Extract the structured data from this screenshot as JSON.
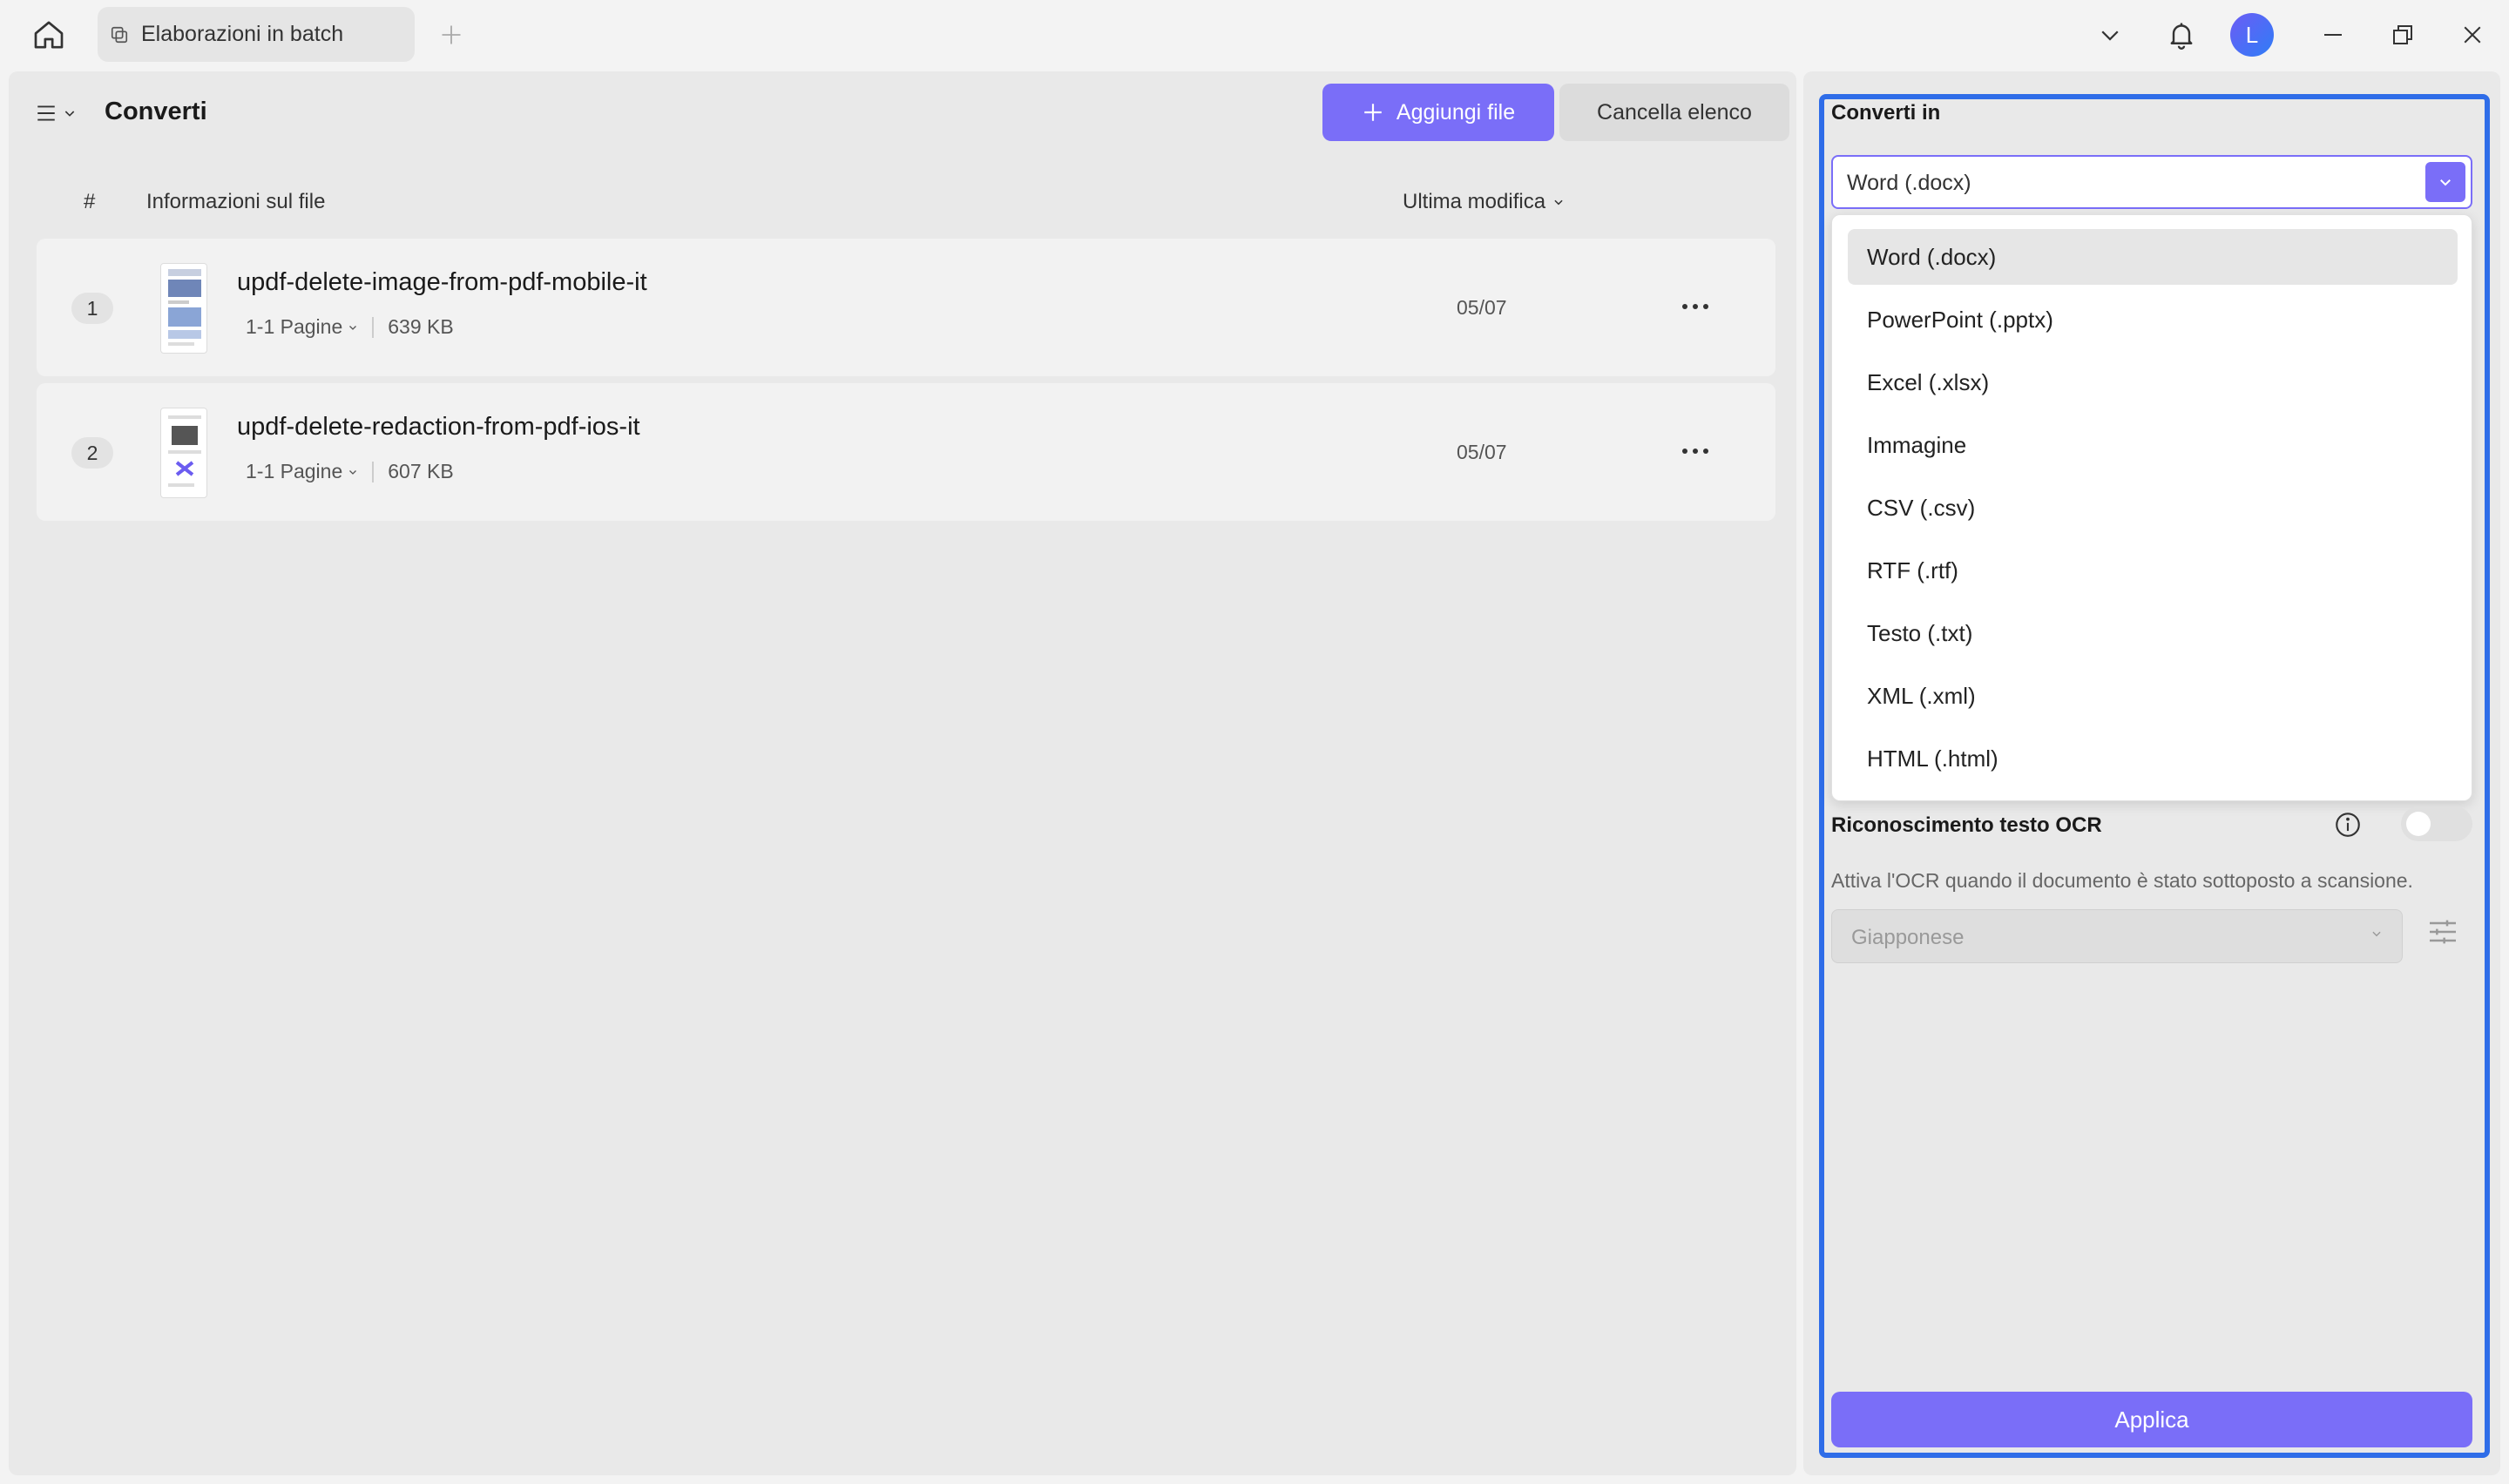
{
  "titlebar": {
    "tab_label": "Elaborazioni in batch",
    "avatar_initial": "L"
  },
  "toolbar": {
    "title": "Converti",
    "add_files_label": "Aggiungi file",
    "clear_list_label": "Cancella elenco"
  },
  "table": {
    "col_number": "#",
    "col_info": "Informazioni sul file",
    "col_modified": "Ultima modifica",
    "rows": [
      {
        "index": "1",
        "name": "updf-delete-image-from-pdf-mobile-it",
        "pages": "1-1 Pagine",
        "size": "639 KB",
        "date": "05/07"
      },
      {
        "index": "2",
        "name": "updf-delete-redaction-from-pdf-ios-it",
        "pages": "1-1 Pagine",
        "size": "607 KB",
        "date": "05/07"
      }
    ]
  },
  "settings": {
    "convert_to_label": "Converti in",
    "selected_format": "Word (.docx)",
    "formats": [
      "Word (.docx)",
      "PowerPoint (.pptx)",
      "Excel (.xlsx)",
      "Immagine",
      "CSV (.csv)",
      "RTF (.rtf)",
      "Testo (.txt)",
      "XML (.xml)",
      "HTML (.html)"
    ],
    "ocr_label": "Riconoscimento testo OCR",
    "ocr_enabled": false,
    "ocr_description": "Attiva l'OCR quando il documento è stato sottoposto a scansione.",
    "ocr_language": "Giapponese",
    "apply_label": "Applica"
  },
  "colors": {
    "accent": "#7a6ef8",
    "focus": "#2f6de8"
  }
}
